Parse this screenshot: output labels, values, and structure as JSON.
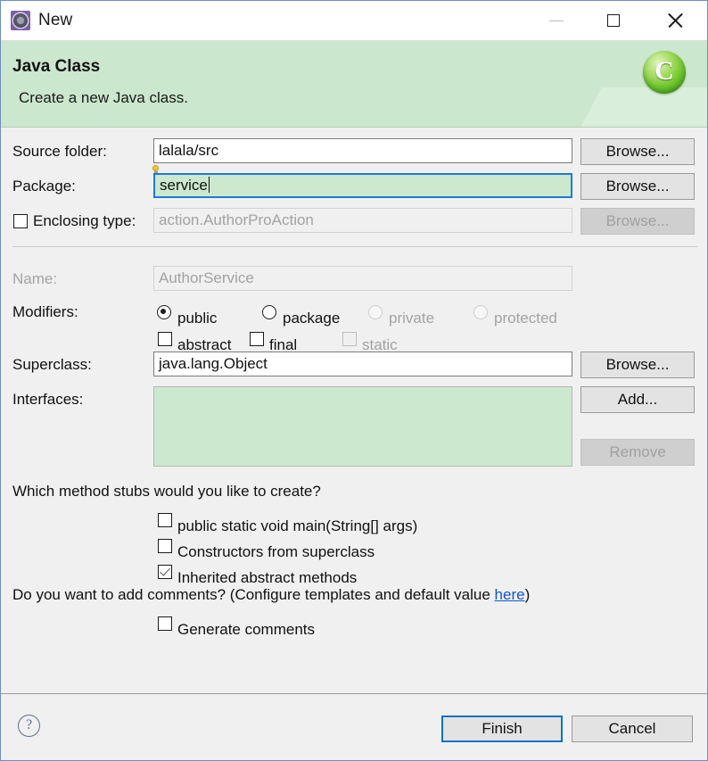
{
  "window": {
    "title": "New",
    "icon": "eclipse-wizard-icon",
    "controls": {
      "minimize": "minimize-icon",
      "maximize": "maximize-icon",
      "close": "close-icon"
    }
  },
  "banner": {
    "title": "Java Class",
    "subtitle": "Create a new Java class.",
    "icon_letter": "C",
    "background_color": "#cbe7cd"
  },
  "form": {
    "source_folder": {
      "label": "Source folder:",
      "value": "lalala/src",
      "button": "Browse..."
    },
    "package": {
      "label": "Package:",
      "value": "service",
      "button": "Browse...",
      "focused": true,
      "focus_color": "#cce8cf",
      "focus_border_color": "#1f7ad4"
    },
    "enclosing_type": {
      "label": "Enclosing type:",
      "checked": false,
      "value": "action.AuthorProAction",
      "button": "Browse...",
      "enabled": false
    },
    "name": {
      "label": "Name:",
      "value": "AuthorService",
      "enabled": false
    },
    "modifiers": {
      "label": "Modifiers:",
      "radios": [
        {
          "label": "public",
          "selected": true,
          "enabled": true
        },
        {
          "label": "package",
          "selected": false,
          "enabled": true
        },
        {
          "label": "private",
          "selected": false,
          "enabled": false
        },
        {
          "label": "protected",
          "selected": false,
          "enabled": false
        }
      ],
      "checkboxes": [
        {
          "label": "abstract",
          "checked": false,
          "enabled": true
        },
        {
          "label": "final",
          "checked": false,
          "enabled": true
        },
        {
          "label": "static",
          "checked": false,
          "enabled": false
        }
      ]
    },
    "superclass": {
      "label": "Superclass:",
      "value": "java.lang.Object",
      "button": "Browse..."
    },
    "interfaces": {
      "label": "Interfaces:",
      "items": [],
      "add_button": "Add...",
      "remove_button": "Remove",
      "remove_enabled": false,
      "background_color": "#cce8cf"
    }
  },
  "stubs": {
    "question": "Which method stubs would you like to create?",
    "options": [
      {
        "label": "public static void main(String[] args)",
        "checked": false
      },
      {
        "label": "Constructors from superclass",
        "checked": false
      },
      {
        "label": "Inherited abstract methods",
        "checked": true
      }
    ]
  },
  "comments": {
    "question_prefix": "Do you want to add comments? (Configure templates and default value ",
    "link_text": "here",
    "question_suffix": ")",
    "option": {
      "label": "Generate comments",
      "checked": false
    }
  },
  "footer": {
    "help_glyph": "?",
    "finish_label": "Finish",
    "cancel_label": "Cancel",
    "default_button": "Finish",
    "default_border_color": "#0d72c4"
  }
}
